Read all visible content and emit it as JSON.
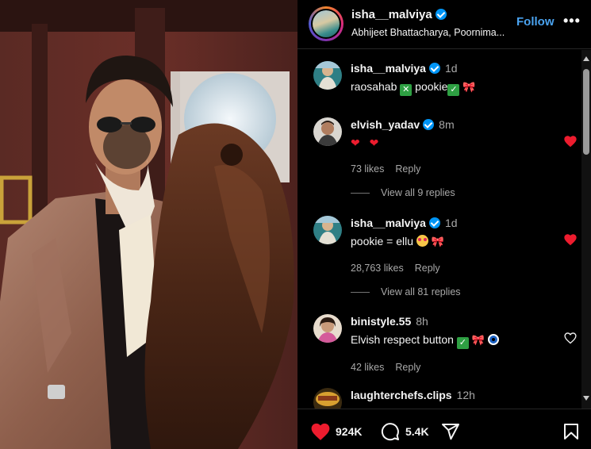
{
  "post": {
    "author": "isha__malviya",
    "collaborators": "Abhijeet Bhattacharya, Poornima...",
    "follow_label": "Follow",
    "more_label": "•••"
  },
  "comments": [
    {
      "username": "isha__malviya",
      "time": "1d",
      "verified": true,
      "text_parts": [
        "raosahab",
        "pookie"
      ]
    },
    {
      "username": "elvish_yadav",
      "time": "8m",
      "verified": true,
      "text": "❤ ❤",
      "likes": "73 likes",
      "reply_label": "Reply",
      "liked": true,
      "view_replies": "View all 9 replies"
    },
    {
      "username": "isha__malviya",
      "time": "1d",
      "verified": true,
      "text": "pookie = ellu",
      "likes": "28,763 likes",
      "reply_label": "Reply",
      "liked": true,
      "view_replies": "View all 81 replies"
    },
    {
      "username": "binistyle.55",
      "time": "8h",
      "verified": false,
      "text": "Elvish respect button",
      "likes": "42 likes",
      "reply_label": "Reply",
      "liked": false
    },
    {
      "username": "laughterchefs.clips",
      "time": "12h",
      "verified": false
    }
  ],
  "actions": {
    "like_count": "924K",
    "comment_count": "5.4K"
  },
  "colors": {
    "accent_blue": "#4aa3f0",
    "like_red": "#ed1c2e",
    "verified_blue": "#0095f6"
  }
}
